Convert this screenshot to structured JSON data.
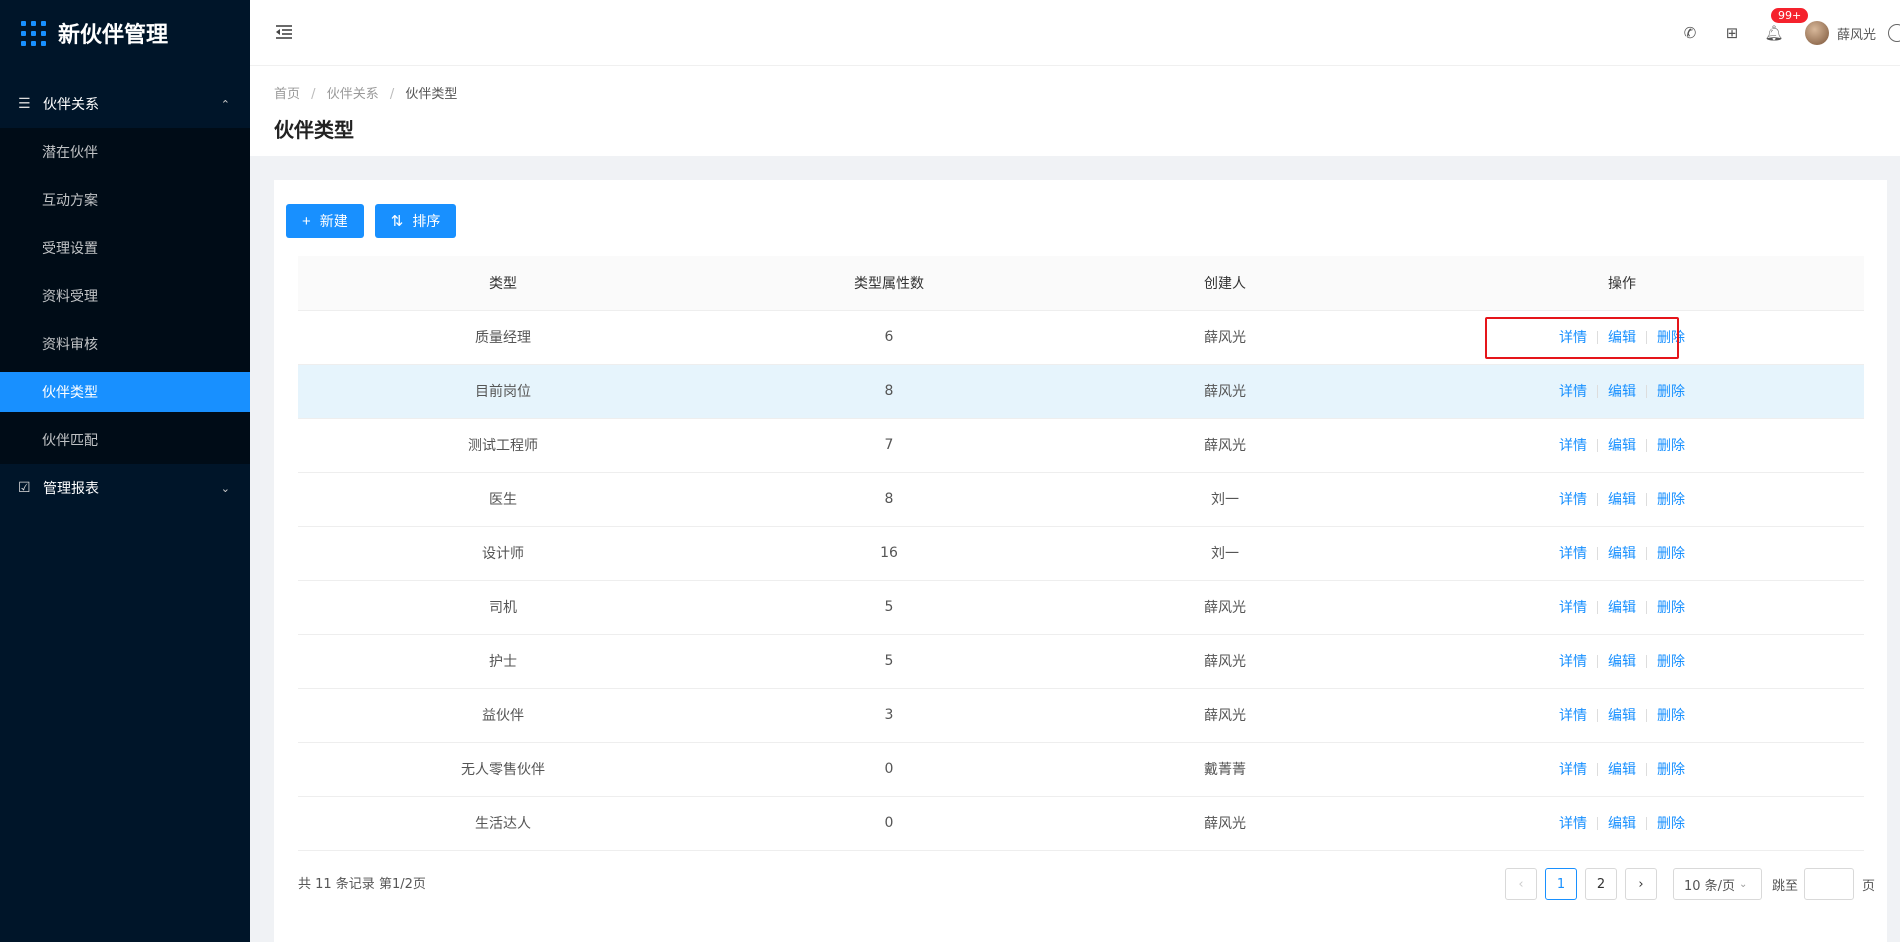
{
  "app": {
    "title": "新伙伴管理"
  },
  "sidebar": {
    "group1": {
      "label": "伙伴关系"
    },
    "items": [
      {
        "label": "潜在伙伴"
      },
      {
        "label": "互动方案"
      },
      {
        "label": "受理设置"
      },
      {
        "label": "资料受理"
      },
      {
        "label": "资料审核"
      },
      {
        "label": "伙伴类型"
      },
      {
        "label": "伙伴匹配"
      }
    ],
    "group2": {
      "label": "管理报表"
    }
  },
  "header": {
    "badge": "99+",
    "user_name": "薛风光"
  },
  "breadcrumb": {
    "home": "首页",
    "level2": "伙伴关系",
    "current": "伙伴类型"
  },
  "page_title": "伙伴类型",
  "toolbar": {
    "new_label": "新建",
    "sort_label": "排序"
  },
  "table": {
    "headers": [
      "类型",
      "类型属性数",
      "创建人",
      "操作"
    ],
    "rows": [
      {
        "type": "质量经理",
        "count": "6",
        "creator": "薛风光"
      },
      {
        "type": "目前岗位",
        "count": "8",
        "creator": "薛风光"
      },
      {
        "type": "测试工程师",
        "count": "7",
        "creator": "薛风光"
      },
      {
        "type": "医生",
        "count": "8",
        "creator": "刘一"
      },
      {
        "type": "设计师",
        "count": "16",
        "creator": "刘一"
      },
      {
        "type": "司机",
        "count": "5",
        "creator": "薛风光"
      },
      {
        "type": "护士",
        "count": "5",
        "creator": "薛风光"
      },
      {
        "type": "益伙伴",
        "count": "3",
        "creator": "薛风光"
      },
      {
        "type": "无人零售伙伴",
        "count": "0",
        "creator": "戴菁菁"
      },
      {
        "type": "生活达人",
        "count": "0",
        "creator": "薛风光"
      }
    ],
    "actions": {
      "detail": "详情",
      "edit": "编辑",
      "delete": "删除"
    }
  },
  "footer": {
    "summary": "共 11 条记录 第1/2页",
    "pages": [
      "1",
      "2"
    ],
    "page_size": "10 条/页",
    "jump_label": "跳至",
    "page_unit": "页"
  }
}
